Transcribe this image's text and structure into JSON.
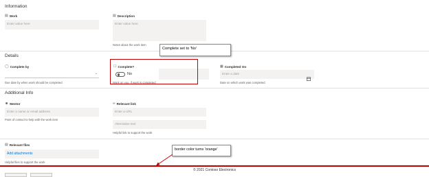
{
  "sections": {
    "information": "Information",
    "details": "Details",
    "additional_info": "Additional Info"
  },
  "fields": {
    "work": {
      "label": "Work",
      "placeholder": "Enter value here"
    },
    "description": {
      "label": "Description",
      "placeholder": "Enter value here",
      "help": "Notes about the work item"
    },
    "complete_by": {
      "label": "Complete by",
      "help": "Due date by when work should be completed"
    },
    "complete": {
      "label": "Complete?",
      "value": "No",
      "help": "Work on you, if work is completed"
    },
    "completed_on": {
      "label": "Completed On",
      "placeholder": "Enter a date",
      "help": "Date on which work was completed"
    },
    "mentor": {
      "label": "Mentor",
      "placeholder": "Enter a name or email address",
      "help": "Point of contact to help with the work item"
    },
    "relevant_link": {
      "label": "Relevant link",
      "url_placeholder": "Enter a URL",
      "alt_placeholder": "Alternative text",
      "help": "Helpful link to support the work"
    },
    "relevant_files": {
      "label": "Relevant files",
      "action": "Add attachments",
      "help": "Helpful files to support the work"
    }
  },
  "callouts": {
    "complete_set": "Complete set to 'No'",
    "border_color": "border color turns 'orange'"
  },
  "footer": {
    "copyright": "© 2021 Contoso Electronics"
  },
  "colors": {
    "annotation_red": "#c00000",
    "accent_blue": "#0078d4",
    "field_bg": "#f3f2f1"
  },
  "icons": {
    "work": "text-field-icon",
    "description": "multiline-text-icon",
    "complete_by": "choice-icon",
    "complete": "checkbox-icon",
    "completed_on": "calendar-icon",
    "mentor": "person-icon",
    "relevant_link": "link-icon",
    "relevant_files": "attachment-icon"
  }
}
